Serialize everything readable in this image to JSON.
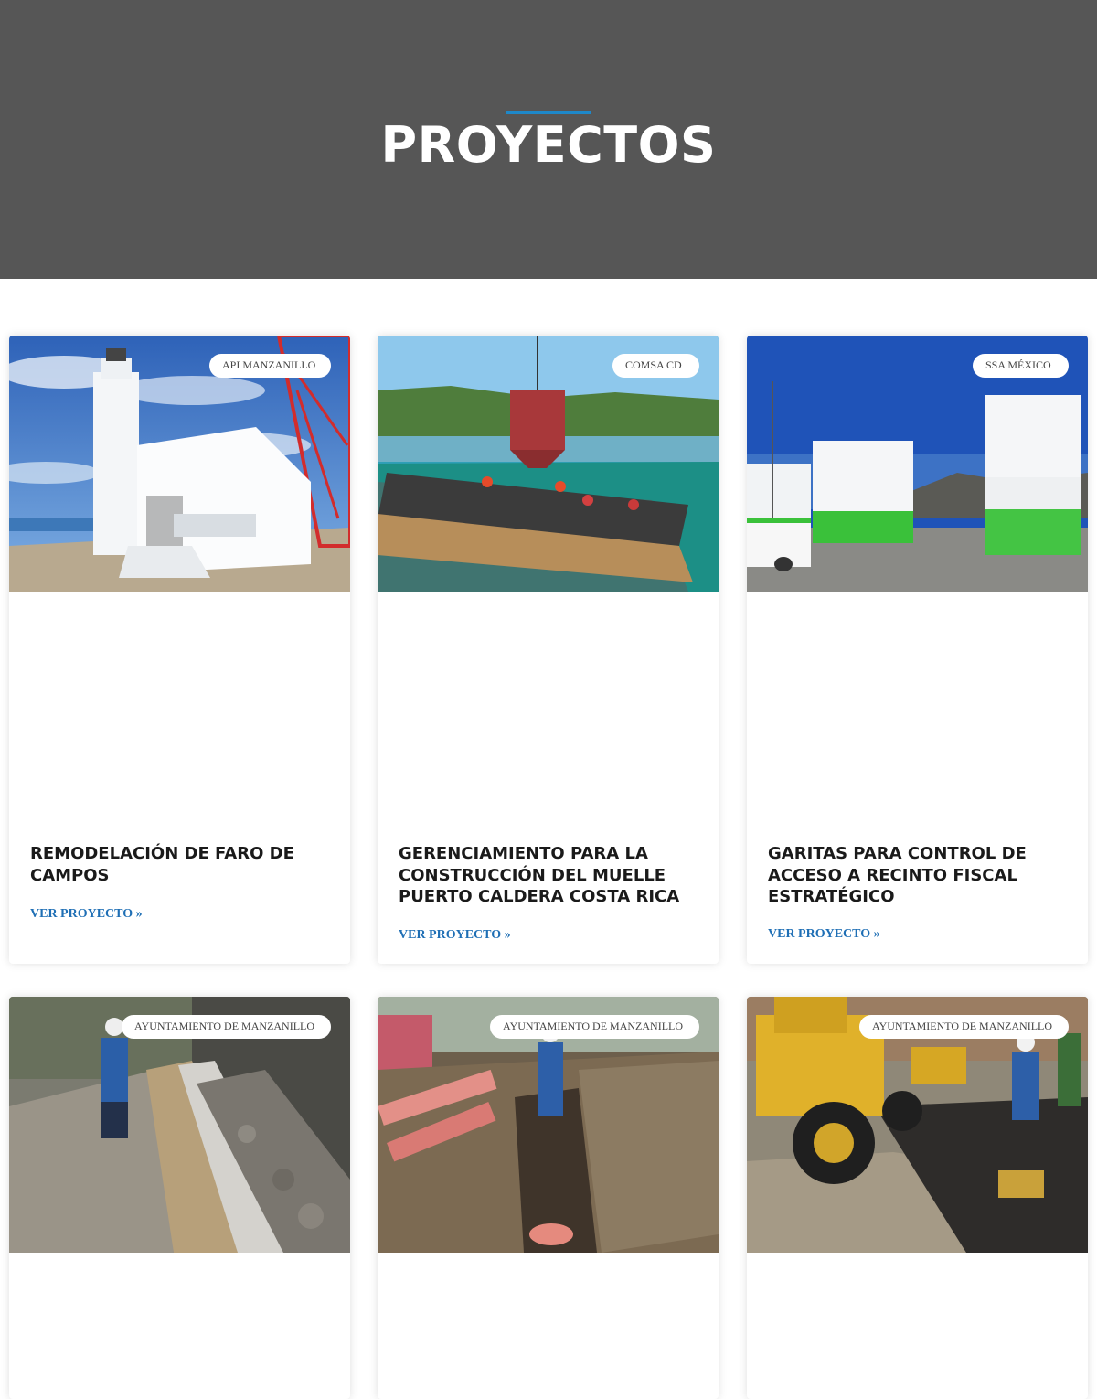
{
  "hero": {
    "title": "PROYECTOS"
  },
  "projects": [
    {
      "client": "API MANZANILLO",
      "title": "REMODELACIÓN DE FARO DE CAMPOS",
      "link": "VER PROYECTO »",
      "image": "lighthouse-photo"
    },
    {
      "client": "COMSA CD",
      "title": "GERENCIAMIENTO PARA LA CONSTRUCCIÓN DEL MUELLE PUERTO CALDERA COSTA RICA",
      "link": "VER PROYECTO »",
      "image": "pier-construction-photo"
    },
    {
      "client": "SSA MÉXICO",
      "title": "GARITAS PARA CONTROL DE ACCESO A RECINTO FISCAL ESTRATÉGICO",
      "link": "VER PROYECTO »",
      "image": "container-booths-photo"
    },
    {
      "client": "AYUNTAMIENTO DE MANZANILLO",
      "image": "drainage-channel-photo"
    },
    {
      "client": "AYUNTAMIENTO DE MANZANILLO",
      "image": "pipe-trench-photo"
    },
    {
      "client": "AYUNTAMIENTO DE MANZANILLO",
      "image": "road-paving-photo"
    }
  ],
  "colors": {
    "hero_bg": "#565656",
    "accent": "#1e88c9",
    "link": "#1f6fb5"
  }
}
